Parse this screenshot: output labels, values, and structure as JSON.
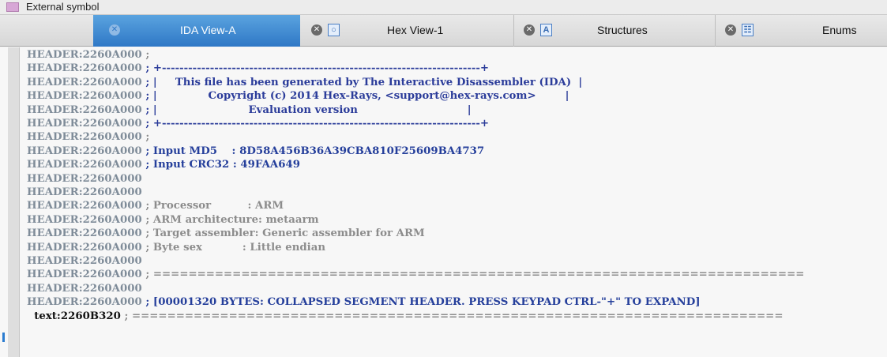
{
  "legend": {
    "label": "External symbol",
    "swatch_color": "#d7a7d6"
  },
  "tabs": [
    {
      "label": "IDA View-A",
      "icon": "close-icon",
      "active": true
    },
    {
      "label": "Hex View-1",
      "icon": "hex-view-icon",
      "active": false
    },
    {
      "label": "Structures",
      "icon": "structures-icon",
      "active": false
    },
    {
      "label": "Enums",
      "icon": "enums-icon",
      "active": false
    }
  ],
  "tab_icon_glyphs": {
    "hex": "○",
    "struct": "A",
    "enums": "☷",
    "close": "✕"
  },
  "listing": {
    "lines": [
      {
        "addr": "HEADER:2260A000",
        "text": " ;"
      },
      {
        "addr": "HEADER:2260A000",
        "text": " ; +-------------------------------------------------------------------------+"
      },
      {
        "addr": "HEADER:2260A000",
        "text": " ; |     This file has been generated by The Interactive Disassembler (IDA)  |"
      },
      {
        "addr": "HEADER:2260A000",
        "text": " ; |              Copyright (c) 2014 Hex-Rays, <support@hex-rays.com>        |"
      },
      {
        "addr": "HEADER:2260A000",
        "text": " ; |                         Evaluation version                              |"
      },
      {
        "addr": "HEADER:2260A000",
        "text": " ; +-------------------------------------------------------------------------+"
      },
      {
        "addr": "HEADER:2260A000",
        "text": " ;"
      },
      {
        "addr": "HEADER:2260A000",
        "text": " ; Input MD5    : 8D58A456B36A39CBA810F25609BA4737"
      },
      {
        "addr": "HEADER:2260A000",
        "text": " ; Input CRC32 : 49FAA649"
      },
      {
        "addr": "HEADER:2260A000",
        "text": ""
      },
      {
        "addr": "HEADER:2260A000",
        "text": ""
      },
      {
        "addr": "HEADER:2260A000",
        "text": " ; Processor          : ARM"
      },
      {
        "addr": "HEADER:2260A000",
        "text": " ; ARM architecture: metaarm"
      },
      {
        "addr": "HEADER:2260A000",
        "text": " ; Target assembler: Generic assembler for ARM"
      },
      {
        "addr": "HEADER:2260A000",
        "text": " ; Byte sex           : Little endian"
      },
      {
        "addr": "HEADER:2260A000",
        "text": ""
      },
      {
        "addr": "HEADER:2260A000",
        "text": " ; =========================================================================="
      },
      {
        "addr": "HEADER:2260A000",
        "text": ""
      },
      {
        "addr": "HEADER:2260A000",
        "text": " ; [00001320 BYTES: COLLAPSED SEGMENT HEADER. PRESS KEYPAD CTRL-\"+\" TO EXPAND]"
      },
      {
        "addr": "  text:2260B320",
        "text": " ; =========================================================================="
      }
    ]
  },
  "colors": {
    "active_tab": "#3b86d2",
    "address": "#7f8c99",
    "banner_text": "#2b3c9a",
    "comment_gray": "#8c8c8c"
  }
}
